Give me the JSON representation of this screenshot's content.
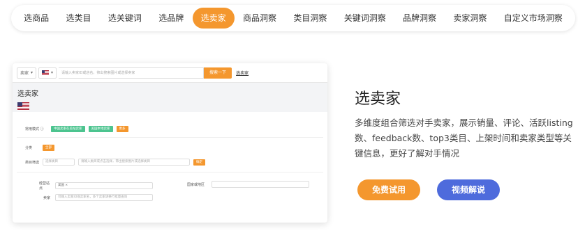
{
  "nav": {
    "tabs": [
      {
        "label": "选商品"
      },
      {
        "label": "选类目"
      },
      {
        "label": "选关键词"
      },
      {
        "label": "选品牌"
      },
      {
        "label": "选卖家",
        "active": true
      },
      {
        "label": "商品洞察"
      },
      {
        "label": "类目洞察"
      },
      {
        "label": "关键词洞察"
      },
      {
        "label": "品牌洞察"
      },
      {
        "label": "卖家洞察"
      },
      {
        "label": "自定义市场洞察"
      }
    ]
  },
  "preview": {
    "search": {
      "type_select": "卖家",
      "placeholder": "请输入卖家ID或店名，筛出搜索图片或选择卖家",
      "button": "搜索一下",
      "link": "选卖家"
    },
    "title": "选卖家",
    "mode_label": "常用模式 ⓘ",
    "mode_chips": [
      "中国卖家在美站卖家",
      "美国本地卖家",
      "更多"
    ],
    "category_label": "分类",
    "category_chip": "全部",
    "filter_label": "类目筛选",
    "filter_select": "选择类目",
    "filter_input": "请输入类目或点击选择，筛出搜索图片或选择类目",
    "filter_button": "确定",
    "site_label": "经营站点",
    "site_value": "美国 ×",
    "country_label": "国家或地区",
    "seller_label": "卖家",
    "seller_input": "可输入卖家ID或卖家名，多个卖家请换行批量查询"
  },
  "feature": {
    "heading": "选卖家",
    "description": "多维度组合筛选对手卖家，展示销量、评论、活跃listing数、feedback数、top3类目、上架时间和卖家类型等关键信息，更好了解对手情况",
    "trial_button": "免费试用",
    "video_button": "视频解说"
  },
  "colors": {
    "accent": "#f4972e",
    "secondary": "#4e6bdc",
    "chip_green": "#4cc48f"
  }
}
